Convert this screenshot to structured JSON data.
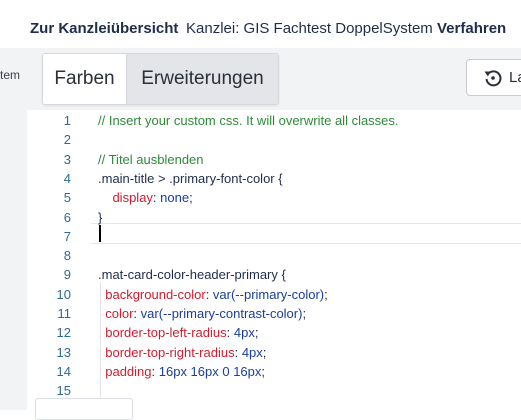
{
  "header": {
    "back_label": "Zur Kanzleiübersicht",
    "kanzlei_label": "Kanzlei: GIS Fachtest DoppelSystem",
    "verfahren_label": "Verfahren"
  },
  "left_panel": {
    "partial_text": "stem"
  },
  "tabs": [
    {
      "label": "Farben",
      "selected": true
    },
    {
      "label": "Erweiterungen",
      "selected": false
    }
  ],
  "reset_button": {
    "label_partial": "La",
    "icon": "reset-icon"
  },
  "editor": {
    "line_numbers": [
      "1",
      "2",
      "3",
      "4",
      "5",
      "6",
      "7",
      "8",
      "9",
      "10",
      "11",
      "12",
      "13",
      "14",
      "15"
    ],
    "lines": [
      {
        "tokens": [
          {
            "type": "comment",
            "text": "// Insert your custom css. It will overwrite all classes."
          }
        ]
      },
      {
        "tokens": []
      },
      {
        "tokens": [
          {
            "type": "comment",
            "text": "// Titel ausblenden"
          }
        ]
      },
      {
        "tokens": [
          {
            "type": "sel",
            "text": ".main-title > .primary-font-color {"
          }
        ]
      },
      {
        "tokens": [
          {
            "type": "punc",
            "text": "    "
          },
          {
            "type": "prop",
            "text": "display"
          },
          {
            "type": "punc",
            "text": ": "
          },
          {
            "type": "val",
            "text": "none"
          },
          {
            "type": "punc",
            "text": ";"
          }
        ]
      },
      {
        "tokens": [
          {
            "type": "sel",
            "text": "}"
          }
        ]
      },
      {
        "tokens": []
      },
      {
        "tokens": []
      },
      {
        "tokens": [
          {
            "type": "sel",
            "text": ".mat-card-color-header-primary {"
          }
        ]
      },
      {
        "tokens": [
          {
            "type": "punc",
            "text": "  "
          },
          {
            "type": "prop",
            "text": "background-color"
          },
          {
            "type": "punc",
            "text": ": "
          },
          {
            "type": "val",
            "text": "var(--primary-color)"
          },
          {
            "type": "punc",
            "text": ";"
          }
        ]
      },
      {
        "tokens": [
          {
            "type": "punc",
            "text": "  "
          },
          {
            "type": "prop",
            "text": "color"
          },
          {
            "type": "punc",
            "text": ": "
          },
          {
            "type": "val",
            "text": "var(--primary-contrast-color)"
          },
          {
            "type": "punc",
            "text": ";"
          }
        ]
      },
      {
        "tokens": [
          {
            "type": "punc",
            "text": "  "
          },
          {
            "type": "prop",
            "text": "border-top-left-radius"
          },
          {
            "type": "punc",
            "text": ": "
          },
          {
            "type": "val",
            "text": "4px"
          },
          {
            "type": "punc",
            "text": ";"
          }
        ]
      },
      {
        "tokens": [
          {
            "type": "punc",
            "text": "  "
          },
          {
            "type": "prop",
            "text": "border-top-right-radius"
          },
          {
            "type": "punc",
            "text": ": "
          },
          {
            "type": "val",
            "text": "4px"
          },
          {
            "type": "punc",
            "text": ";"
          }
        ]
      },
      {
        "tokens": [
          {
            "type": "punc",
            "text": "  "
          },
          {
            "type": "prop",
            "text": "padding"
          },
          {
            "type": "punc",
            "text": ": "
          },
          {
            "type": "val",
            "text": "16px 16px 0 16px"
          },
          {
            "type": "punc",
            "text": ";"
          }
        ]
      },
      {
        "tokens": []
      }
    ]
  }
}
